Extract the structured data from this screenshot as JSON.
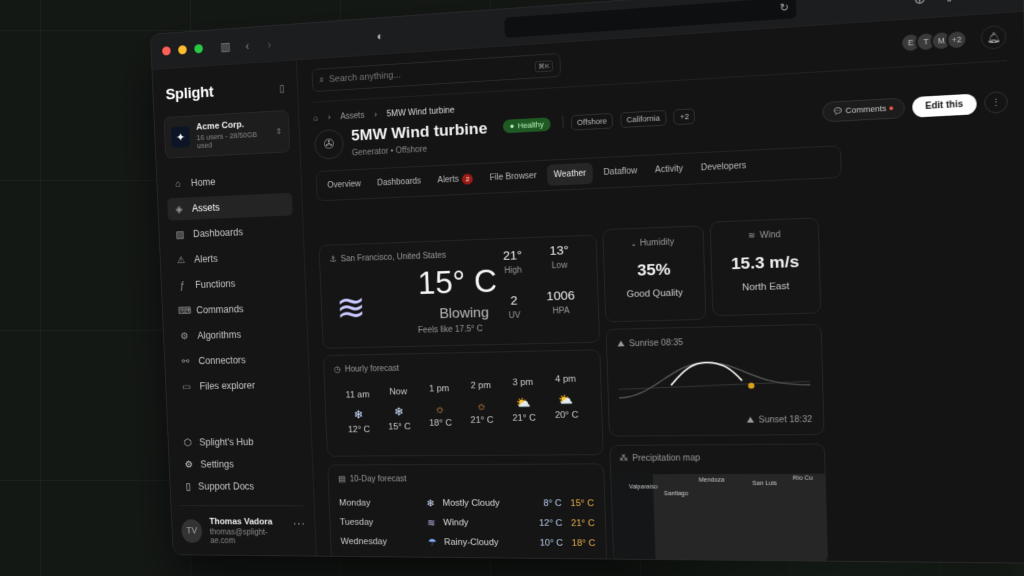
{
  "browser": {
    "window_controls": [
      "close",
      "minimize",
      "maximize"
    ],
    "toolbar_icons": [
      "download-icon",
      "share-icon",
      "new-tab-icon",
      "tabs-icon"
    ]
  },
  "sidebar": {
    "brand": "Splight",
    "org": {
      "name": "Acme Corp.",
      "sub": "16 users - 28/50GB used"
    },
    "items": [
      {
        "label": "Home",
        "icon": "⌂",
        "name": "home"
      },
      {
        "label": "Assets",
        "icon": "◈",
        "name": "assets",
        "active": true
      },
      {
        "label": "Dashboards",
        "icon": "▨",
        "name": "dashboards"
      },
      {
        "label": "Alerts",
        "icon": "⚠",
        "name": "alerts"
      },
      {
        "label": "Functions",
        "icon": "ƒ",
        "name": "functions"
      },
      {
        "label": "Commands",
        "icon": "⌨",
        "name": "commands"
      },
      {
        "label": "Algorithms",
        "icon": "⚙",
        "name": "algorithms"
      },
      {
        "label": "Connectors",
        "icon": "⚯",
        "name": "connectors"
      },
      {
        "label": "Files explorer",
        "icon": "▭",
        "name": "files-explorer"
      }
    ],
    "footer": [
      {
        "label": "Splight's Hub",
        "icon": "⬡"
      },
      {
        "label": "Settings",
        "icon": "⚙"
      },
      {
        "label": "Support Docs",
        "icon": "▯"
      }
    ],
    "user": {
      "initials": "TV",
      "name": "Thomas Vadora",
      "email": "thomas@splight-ae.com"
    }
  },
  "topbar": {
    "search_placeholder": "Search anything...",
    "shortcut": "⌘K",
    "avatars": [
      "E",
      "T",
      "M",
      "+2"
    ]
  },
  "breadcrumb": [
    "Assets",
    "5MW Wind turbine"
  ],
  "asset": {
    "title": "5MW Wind turbine",
    "status": "Healthy",
    "type": "Generator",
    "location": "Offshore",
    "tags": [
      "Offshore",
      "California",
      "+2"
    ]
  },
  "actions": {
    "comments": "Comments",
    "edit": "Edit this"
  },
  "tabs": [
    {
      "label": "Overview"
    },
    {
      "label": "Dashboards"
    },
    {
      "label": "Alerts",
      "count": "2"
    },
    {
      "label": "File Browser"
    },
    {
      "label": "Weather",
      "active": true
    },
    {
      "label": "Dataflow"
    },
    {
      "label": "Activity"
    },
    {
      "label": "Developers"
    }
  ],
  "weather": {
    "location": "San Francisco, United States",
    "temp": "15° C",
    "condition": "Blowing",
    "feels": "Feels like 17.5° C",
    "high": "21°",
    "high_label": "High",
    "low": "13°",
    "low_label": "Low",
    "uv": "2",
    "uv_label": "UV",
    "pressure": "1006",
    "pressure_label": "HPA",
    "humidity": {
      "label": "Humidity",
      "value": "35%",
      "quality": "Good Quality"
    },
    "wind": {
      "label": "Wind",
      "value": "15.3 m/s",
      "direction": "North East"
    },
    "hourly": {
      "label": "Hourly forecast",
      "items": [
        {
          "time": "11 am",
          "icon": "❄",
          "color": "#cfe0ff",
          "temp": "12° C"
        },
        {
          "time": "Now",
          "icon": "❄",
          "color": "#cfe0ff",
          "temp": "15° C"
        },
        {
          "time": "1 pm",
          "icon": "☼",
          "color": "#f0a040",
          "temp": "18° C"
        },
        {
          "time": "2 pm",
          "icon": "☼",
          "color": "#f0a040",
          "temp": "21° C"
        },
        {
          "time": "3 pm",
          "icon": "⛅",
          "color": "#f0c060",
          "temp": "21° C"
        },
        {
          "time": "4 pm",
          "icon": "⛅",
          "color": "#f0c060",
          "temp": "20° C"
        }
      ]
    },
    "sun": {
      "sunrise": "Sunrise 08:35",
      "sunset": "Sunset 18:32"
    },
    "ten_day": {
      "label": "10-Day forecast",
      "days": [
        {
          "day": "Monday",
          "icon": "❄",
          "color": "#cfe0ff",
          "cond": "Mostly Cloudy",
          "lo": "8° C",
          "hi": "15° C"
        },
        {
          "day": "Tuesday",
          "icon": "≋",
          "color": "#b8b8f0",
          "cond": "Windy",
          "lo": "12° C",
          "hi": "21° C"
        },
        {
          "day": "Wednesday",
          "icon": "☂",
          "color": "#7fb0ff",
          "cond": "Rainy-Cloudy",
          "lo": "10° C",
          "hi": "18° C"
        }
      ]
    },
    "map": {
      "label": "Precipitation map",
      "cities": [
        "Valparaíso",
        "Santiago",
        "Mendoza",
        "San Luis",
        "Río Cu"
      ]
    }
  }
}
